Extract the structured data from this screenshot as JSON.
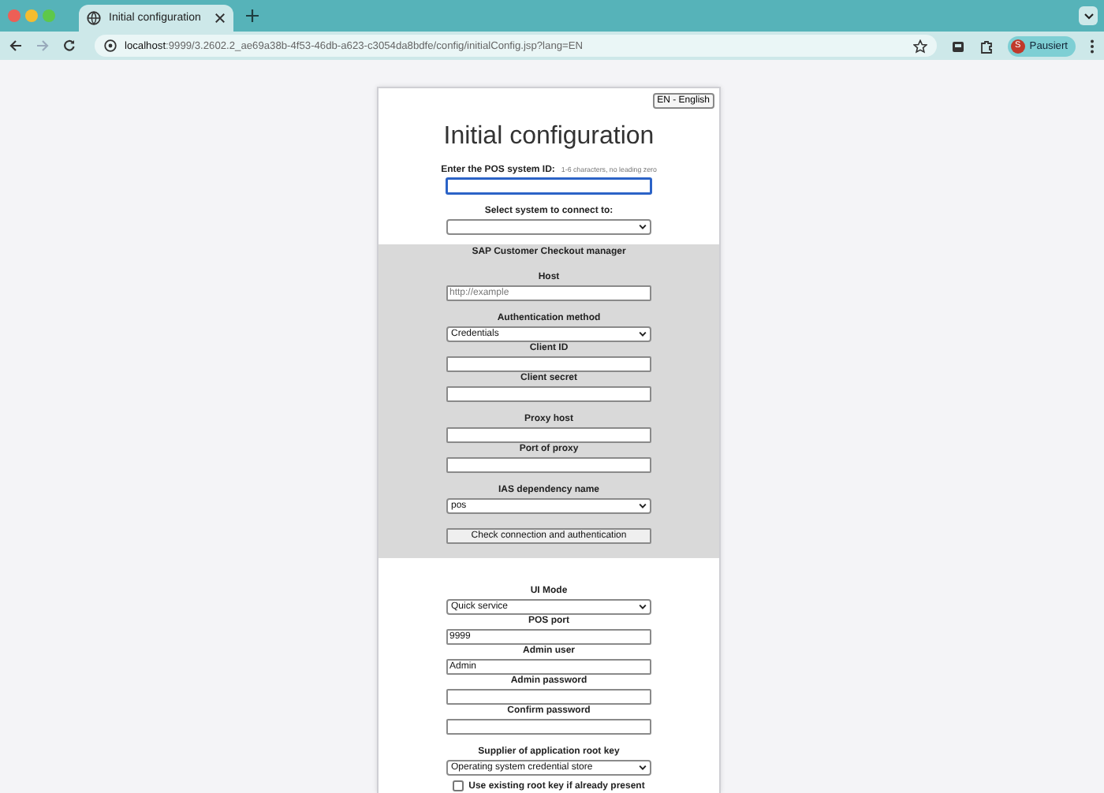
{
  "browser": {
    "tabs": [
      {
        "title": "Initial configuration",
        "selected": true
      }
    ],
    "url": {
      "host": "localhost",
      "path": ":9999/3.2602.2_ae69a38b-4f53-46db-a623-c3054da8bdfe/config/initialConfig.jsp?lang=EN"
    },
    "forward_disabled": true,
    "profile": {
      "initial": "S",
      "label": "Pausiert"
    }
  },
  "page": {
    "language": "EN - English",
    "title": "Initial configuration",
    "sections": [
      {
        "kind": "plain",
        "groups": [
          [
            {
              "label": "Enter the POS system ID:",
              "hint": "1-6 characters, no leading zero",
              "control": {
                "kind": "input",
                "focused": true
              }
            }
          ],
          [
            {
              "label": "Select system to connect to:",
              "control": {
                "kind": "select"
              }
            }
          ]
        ]
      },
      {
        "kind": "shaded",
        "title": "SAP Customer Checkout manager",
        "groups": [
          [
            {
              "label": "Host",
              "control": {
                "kind": "input",
                "placeholder": "http://example"
              }
            }
          ],
          [
            {
              "label": "Authentication method",
              "control": {
                "kind": "select",
                "value": "Credentials"
              }
            },
            {
              "label": "Client ID",
              "control": {
                "kind": "input"
              }
            },
            {
              "label": "Client secret",
              "control": {
                "kind": "input"
              }
            }
          ],
          [
            {
              "label": "Proxy host",
              "control": {
                "kind": "input"
              }
            },
            {
              "label": "Port of proxy",
              "control": {
                "kind": "input"
              }
            }
          ],
          [
            {
              "label": "IAS dependency name",
              "control": {
                "kind": "select",
                "value": "pos"
              }
            }
          ],
          [
            {
              "control": {
                "kind": "button",
                "value": "Check connection and authentication"
              }
            }
          ]
        ]
      },
      {
        "kind": "plain",
        "groups": [
          [
            {
              "label": "UI Mode",
              "control": {
                "kind": "select",
                "value": "Quick service"
              }
            },
            {
              "label": "POS port",
              "control": {
                "kind": "input",
                "value": "9999"
              }
            },
            {
              "label": "Admin user",
              "control": {
                "kind": "input",
                "value": "Admin"
              }
            },
            {
              "label": "Admin password",
              "control": {
                "kind": "input"
              }
            },
            {
              "label": "Confirm password",
              "control": {
                "kind": "input"
              }
            }
          ],
          [
            {
              "label": "Supplier of application root key",
              "control": {
                "kind": "select",
                "value": "Operating system credential store"
              }
            },
            {
              "control": {
                "kind": "checkbox",
                "value": "Use existing root key if already present",
                "checked": false
              }
            }
          ]
        ]
      }
    ]
  }
}
